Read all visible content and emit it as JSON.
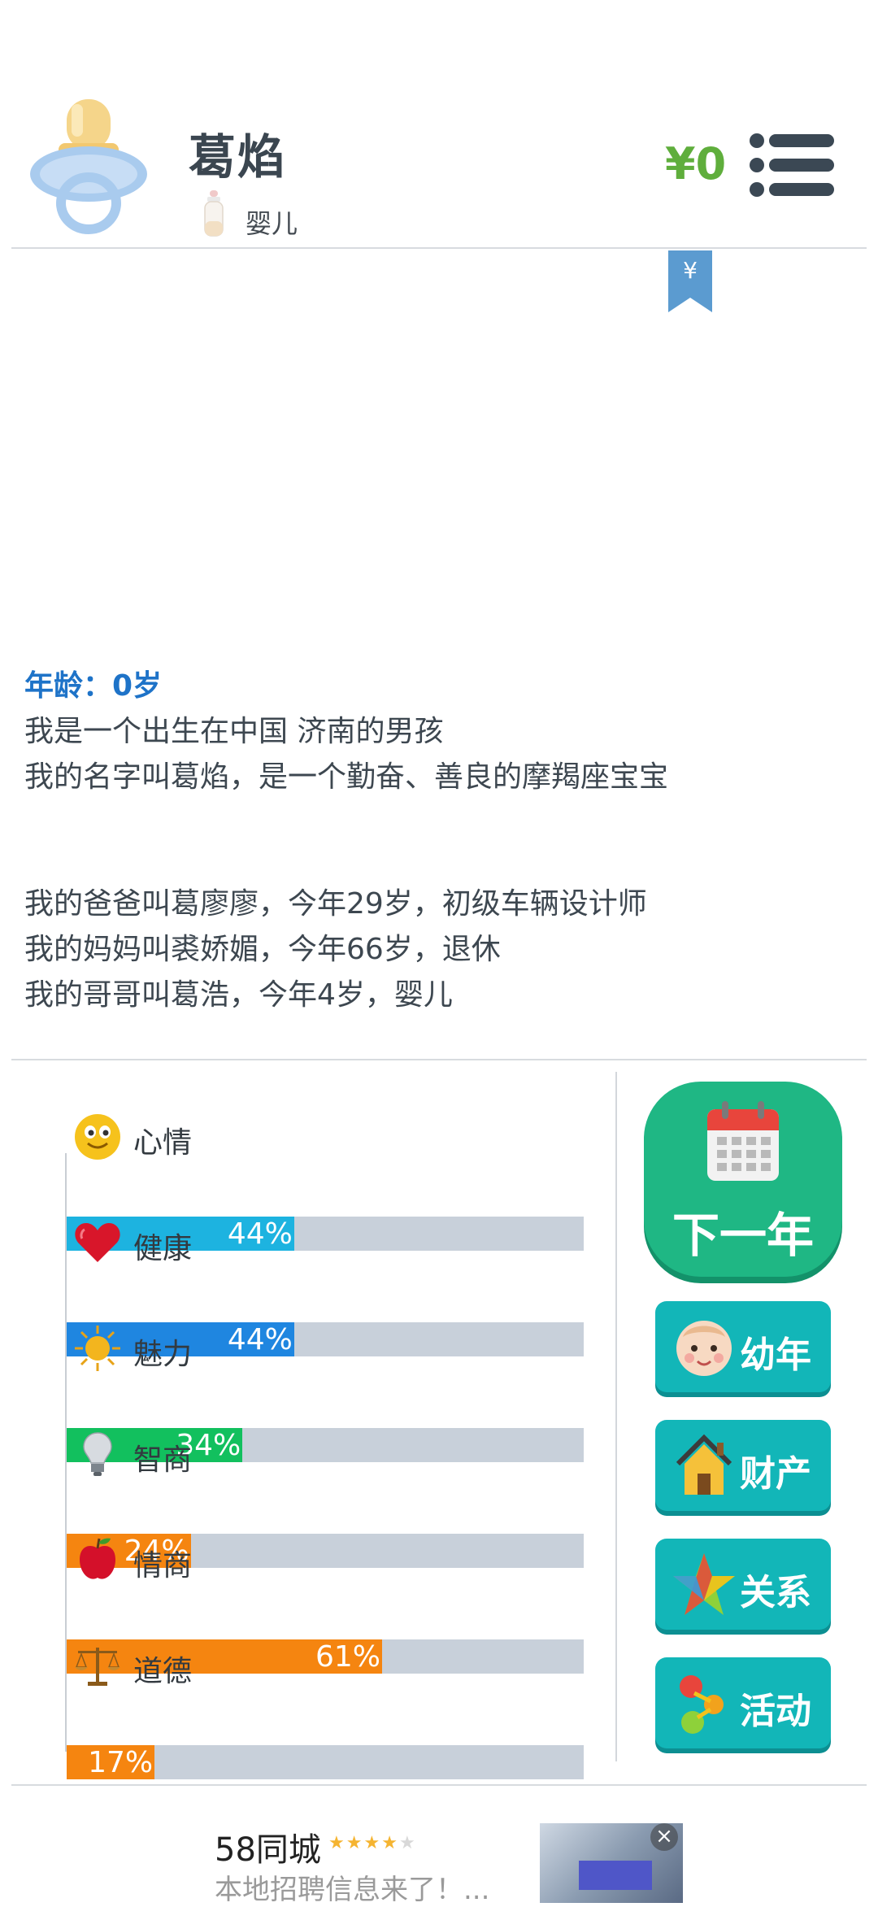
{
  "header": {
    "name": "葛焰",
    "stage": "婴儿",
    "money": "¥0",
    "bookmark_symbol": "¥"
  },
  "story": {
    "age": "年龄：0岁",
    "intro_lines": [
      "我是一个出生在中国 济南的男孩",
      "我的名字叫葛焰，是一个勤奋、善良的摩羯座宝宝"
    ],
    "family_lines": [
      "我的爸爸叫葛廖廖，今年29岁，初级车辆设计师",
      "我的妈妈叫裘娇媚，今年66岁，退休",
      "我的哥哥叫葛浩，今年4岁，婴儿"
    ]
  },
  "stats": [
    {
      "label": "心情",
      "percent": 44,
      "percent_text": "44%",
      "color": "#1db3e0",
      "icon": "smiley-icon"
    },
    {
      "label": "健康",
      "percent": 44,
      "percent_text": "44%",
      "color": "#1f86e0",
      "icon": "heart-icon"
    },
    {
      "label": "魅力",
      "percent": 34,
      "percent_text": "34%",
      "color": "#12c05e",
      "icon": "sun-icon"
    },
    {
      "label": "智商",
      "percent": 24,
      "percent_text": "24%",
      "color": "#f58510",
      "icon": "lightbulb-icon"
    },
    {
      "label": "情商",
      "percent": 61,
      "percent_text": "61%",
      "color": "#f58510",
      "icon": "apple-icon"
    },
    {
      "label": "道德",
      "percent": 17,
      "percent_text": "17%",
      "color": "#f58510",
      "icon": "scales-icon"
    }
  ],
  "actions": {
    "next_year": "下一年",
    "childhood": "幼年",
    "property": "财产",
    "relations": "关系",
    "activities": "活动"
  },
  "ad": {
    "brand": "58同城",
    "rating_stars": 4,
    "rating_max": 5,
    "description": "本地招聘信息来了！...",
    "close_symbol": "×"
  }
}
